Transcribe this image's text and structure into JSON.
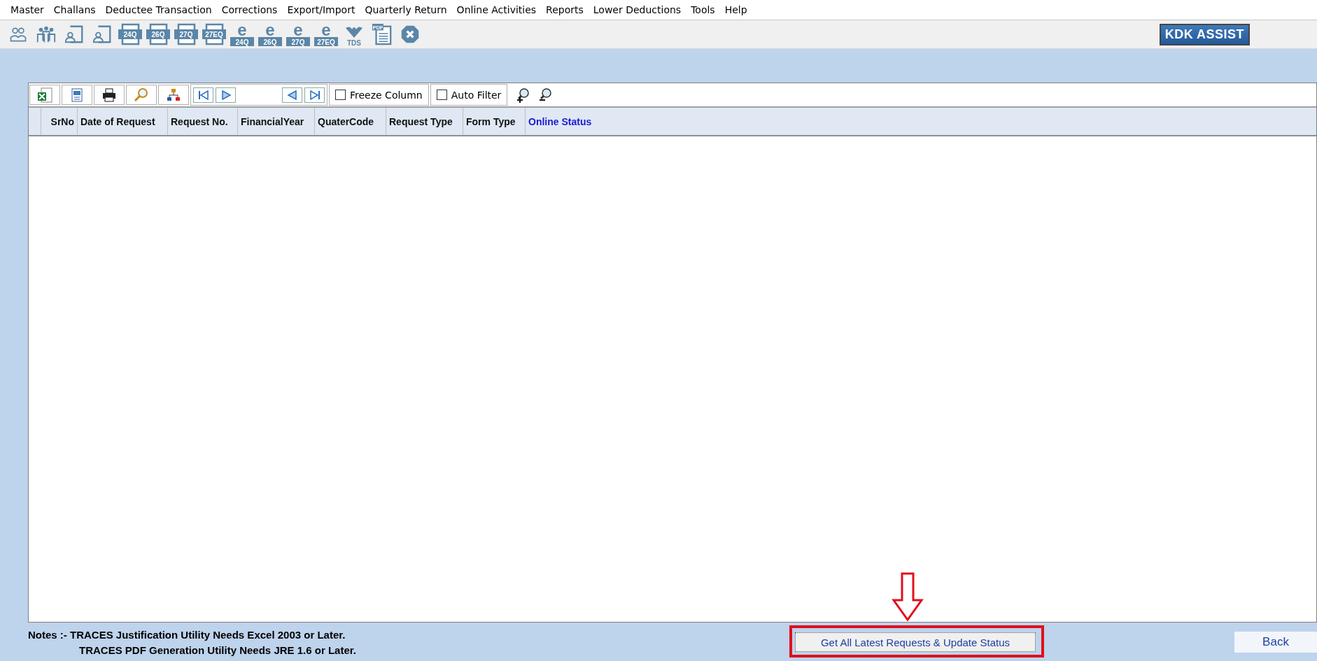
{
  "menu": [
    {
      "label": "Master"
    },
    {
      "label": "Challans"
    },
    {
      "label": "Deductee Transaction"
    },
    {
      "label": "Corrections"
    },
    {
      "label": "Export/Import"
    },
    {
      "label": "Quarterly Return"
    },
    {
      "label": "Online Activities"
    },
    {
      "label": "Reports"
    },
    {
      "label": "Lower Deductions"
    },
    {
      "label": "Tools"
    },
    {
      "label": "Help"
    }
  ],
  "toolbar": [
    {
      "kind": "person"
    },
    {
      "kind": "people"
    },
    {
      "kind": "form-person"
    },
    {
      "kind": "form-person"
    },
    {
      "kind": "form",
      "label": "24Q"
    },
    {
      "kind": "form",
      "label": "26Q"
    },
    {
      "kind": "form",
      "label": "27Q"
    },
    {
      "kind": "form",
      "label": "27EQ"
    },
    {
      "kind": "e-form",
      "letter": "e",
      "label": "24Q"
    },
    {
      "kind": "e-form",
      "letter": "e",
      "label": "26Q"
    },
    {
      "kind": "e-form",
      "letter": "e",
      "label": "27Q"
    },
    {
      "kind": "e-form",
      "letter": "e",
      "label": "27EQ"
    },
    {
      "kind": "tds",
      "label": "TDS"
    },
    {
      "kind": "pdf",
      "label": "PDF"
    },
    {
      "kind": "close"
    }
  ],
  "assist_button": "KDK ASSIST",
  "grid_toolbar": {
    "buttons": [
      {
        "kind": "excel"
      },
      {
        "kind": "xml"
      },
      {
        "kind": "print"
      },
      {
        "kind": "find"
      },
      {
        "kind": "tree"
      }
    ],
    "nav_left": [
      {
        "kind": "first"
      },
      {
        "kind": "next"
      }
    ],
    "nav_right": [
      {
        "kind": "prev"
      },
      {
        "kind": "last"
      }
    ],
    "checkboxes": [
      {
        "label": "Freeze Column",
        "checked": false
      },
      {
        "label": "Auto Filter",
        "checked": false
      }
    ],
    "zoom_buttons": [
      {
        "kind": "zoom-in"
      },
      {
        "kind": "zoom-out"
      }
    ]
  },
  "table": {
    "columns": [
      {
        "label": "SrNo",
        "highlight": false
      },
      {
        "label": "Date of Request",
        "highlight": false
      },
      {
        "label": "Request No.",
        "highlight": false
      },
      {
        "label": "FinancialYear",
        "highlight": false
      },
      {
        "label": "QuaterCode",
        "highlight": false
      },
      {
        "label": "Request Type",
        "highlight": false
      },
      {
        "label": "Form Type",
        "highlight": false
      },
      {
        "label": "Online Status",
        "highlight": true
      }
    ]
  },
  "notes": [
    "Notes :- TRACES Justification Utility Needs Excel 2003 or Later.",
    "TRACES PDF Generation Utility Needs JRE 1.6 or Later."
  ],
  "update_button": "Get All Latest Requests & Update Status",
  "back_button": {
    "label": "Back"
  }
}
